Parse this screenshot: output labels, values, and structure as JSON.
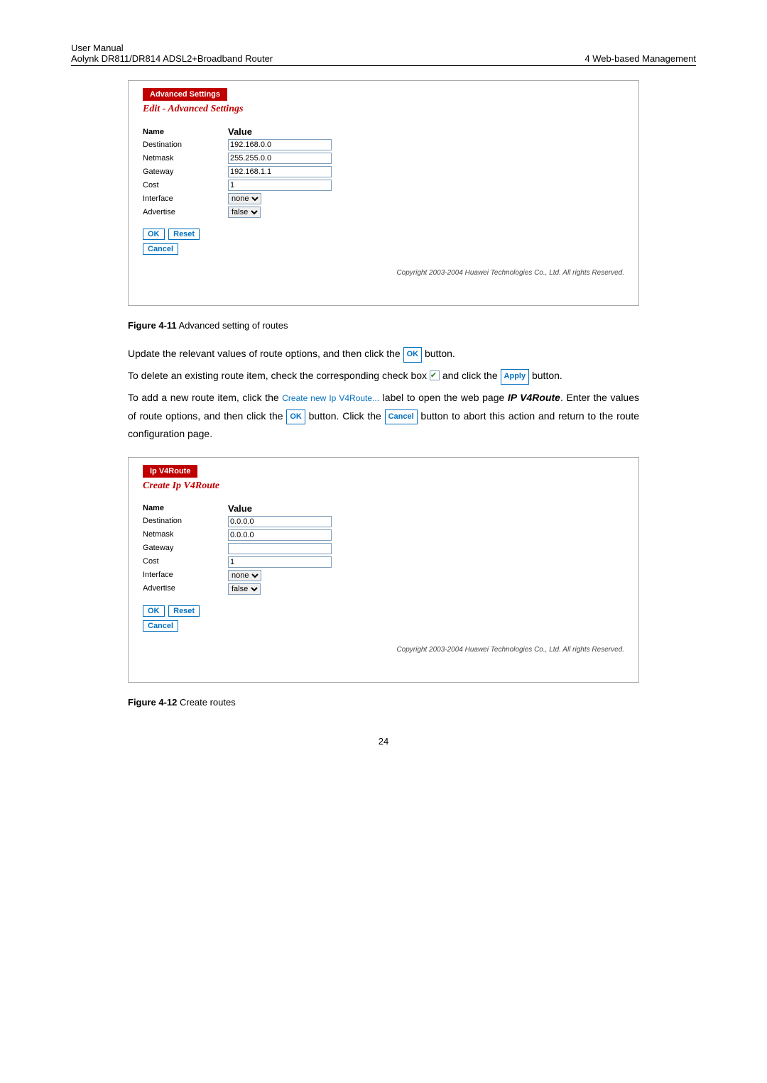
{
  "header": {
    "line1": "User Manual",
    "line2": "Aolynk DR811/DR814 ADSL2+Broadband Router",
    "right": "4  Web-based Management"
  },
  "panel1": {
    "tab": "Advanced Settings",
    "title": "Edit - Advanced Settings",
    "nameHeader": "Name",
    "valueHeader": "Value",
    "rows": {
      "destination": {
        "label": "Destination",
        "value": "192.168.0.0"
      },
      "netmask": {
        "label": "Netmask",
        "value": "255.255.0.0"
      },
      "gateway": {
        "label": "Gateway",
        "value": "192.168.1.1"
      },
      "cost": {
        "label": "Cost",
        "value": "1"
      },
      "interface": {
        "label": "Interface",
        "value": "none"
      },
      "advertise": {
        "label": "Advertise",
        "value": "false"
      }
    },
    "buttons": {
      "ok": "OK",
      "reset": "Reset",
      "cancel": "Cancel"
    },
    "copyright": "Copyright 2003-2004 Huawei Technologies Co., Ltd. All rights Reserved."
  },
  "caption1": {
    "bold": "Figure 4-11",
    "text": " Advanced setting of routes"
  },
  "para1": {
    "pre": "Update the relevant values of route options, and then click the ",
    "btn": "OK",
    "post": " button."
  },
  "para2": {
    "pre": "To delete an existing route item, check the corresponding check box ",
    "mid": " and click the ",
    "btn": "Apply",
    "post": " button."
  },
  "para3": {
    "pre": "To add a new route item, click the ",
    "link": "Create new Ip V4Route...",
    "mid1": "  label to open the web page ",
    "bi": "IP V4Route",
    "mid2": ". Enter the values of route options, and then click the ",
    "btn1": "OK",
    "mid3": " button. Click the ",
    "btn2": "Cancel",
    "post": " button to abort this action and return to the route configuration page."
  },
  "panel2": {
    "tab": "Ip V4Route",
    "title": "Create Ip V4Route",
    "nameHeader": "Name",
    "valueHeader": "Value",
    "rows": {
      "destination": {
        "label": "Destination",
        "value": "0.0.0.0"
      },
      "netmask": {
        "label": "Netmask",
        "value": "0.0.0.0"
      },
      "gateway": {
        "label": "Gateway",
        "value": ""
      },
      "cost": {
        "label": "Cost",
        "value": "1"
      },
      "interface": {
        "label": "Interface",
        "value": "none"
      },
      "advertise": {
        "label": "Advertise",
        "value": "false"
      }
    },
    "buttons": {
      "ok": "OK",
      "reset": "Reset",
      "cancel": "Cancel"
    },
    "copyright": "Copyright 2003-2004 Huawei Technologies Co., Ltd. All rights Reserved."
  },
  "caption2": {
    "bold": "Figure 4-12",
    "text": " Create routes"
  },
  "pageNumber": "24"
}
